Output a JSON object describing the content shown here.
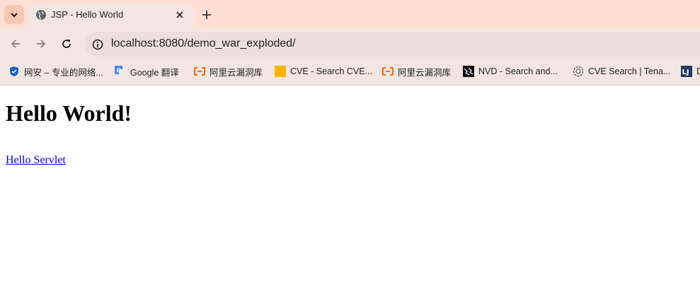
{
  "tab": {
    "title": "JSP - Hello World",
    "icons": {
      "search": "chevron-down-icon",
      "favicon": "globe-icon",
      "close": "close-icon",
      "new": "plus-icon"
    }
  },
  "toolbar": {
    "url": "localhost:8080/demo_war_exploded/",
    "icons": {
      "back": "arrow-left-icon",
      "forward": "arrow-right-icon",
      "reload": "reload-icon",
      "info": "info-icon"
    }
  },
  "bookmarks": [
    {
      "label": "网安 – 专业的网络...",
      "icon": "shield-icon"
    },
    {
      "label": "Google 翻译",
      "icon": "google-translate-icon"
    },
    {
      "label": "阿里云漏洞库",
      "icon": "aliyun-icon"
    },
    {
      "label": "CVE - Search CVE...",
      "icon": "cve-icon"
    },
    {
      "label": "阿里云漏洞库",
      "icon": "aliyun-icon"
    },
    {
      "label": "NVD - Search and...",
      "icon": "nvd-icon"
    },
    {
      "label": "CVE Search | Tena...",
      "icon": "tenable-icon"
    },
    {
      "label": "D",
      "icon": "lj-icon"
    }
  ],
  "page": {
    "heading": "Hello World!",
    "link": "Hello Servlet"
  },
  "colors": {
    "tabstrip": "#ffdfd3",
    "toolbar": "#f3e6e2",
    "link": "#0000ee"
  }
}
